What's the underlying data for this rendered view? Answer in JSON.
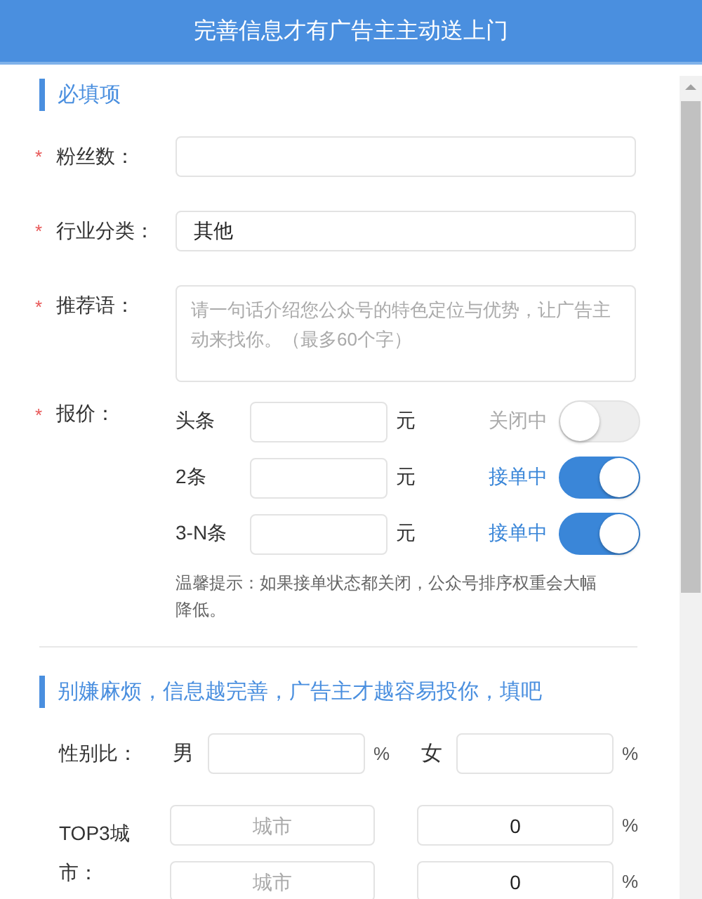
{
  "header": {
    "title": "完善信息才有广告主主动送上门"
  },
  "required_section": {
    "title": "必填项",
    "fans": {
      "mark": "*",
      "label": "粉丝数："
    },
    "industry": {
      "mark": "*",
      "label": "行业分类：",
      "value": "其他"
    },
    "recommendation": {
      "mark": "*",
      "label": "推荐语：",
      "placeholder": "请一句话介绍您公众号的特色定位与优势，让广告主动来找你。（最多60个字）"
    },
    "price": {
      "mark": "*",
      "label": "报价：",
      "rows": [
        {
          "label": "头条",
          "unit": "元",
          "status": "关闭中",
          "on": false
        },
        {
          "label": "2条",
          "unit": "元",
          "status": "接单中",
          "on": true
        },
        {
          "label": "3-N条",
          "unit": "元",
          "status": "接单中",
          "on": true
        }
      ],
      "hint": "温馨提示：如果接单状态都关闭，公众号排序权重会大幅降低。"
    }
  },
  "optional_section": {
    "title": "别嫌麻烦，信息越完善，广告主才越容易投你，填吧",
    "gender": {
      "label": "性别比：",
      "fields": [
        {
          "label": "男",
          "unit": "%"
        },
        {
          "label": "女",
          "unit": "%"
        }
      ]
    },
    "cities": {
      "label": "TOP3城市：",
      "rows": [
        {
          "placeholder": "城市",
          "value": "0",
          "unit": "%"
        },
        {
          "placeholder": "城市",
          "value": "0",
          "unit": "%"
        }
      ]
    }
  }
}
